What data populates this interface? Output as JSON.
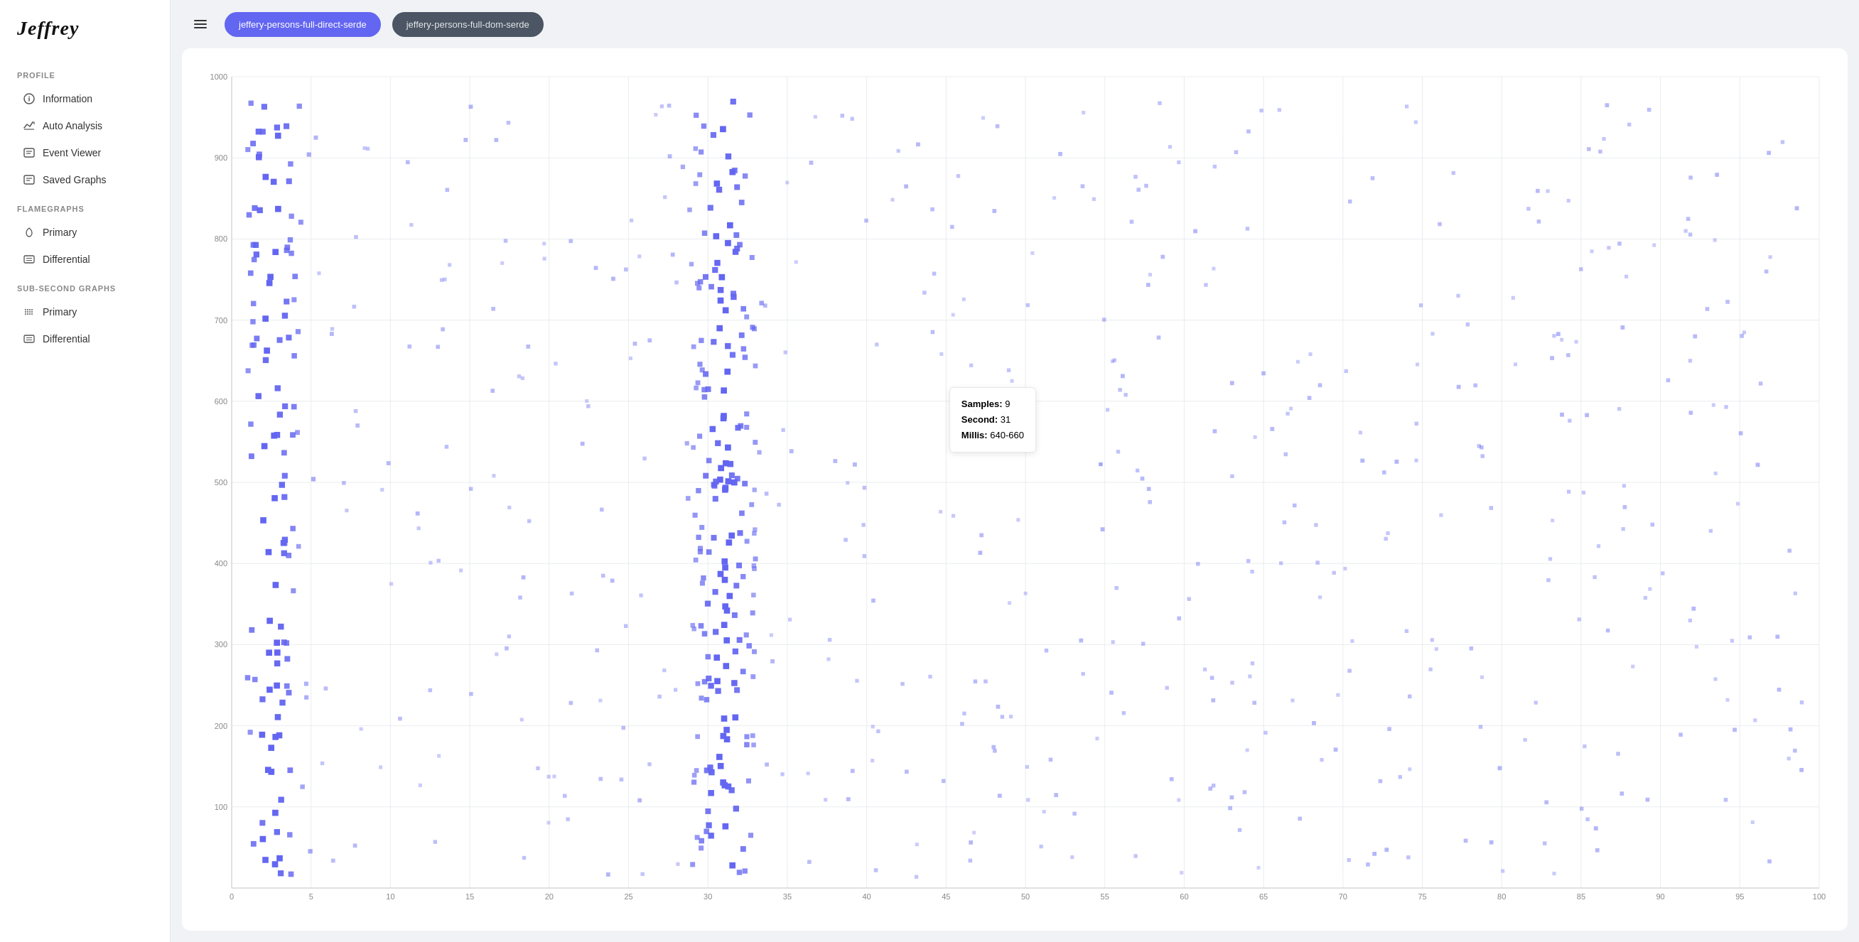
{
  "logo": "Jeffrey",
  "sidebar": {
    "profile_label": "PROFILE",
    "flamegraphs_label": "FLAMEGRAPHS",
    "subsecond_label": "SUB-SECOND GRAPHS",
    "items": {
      "information": "Information",
      "auto_analysis": "Auto Analysis",
      "event_viewer": "Event Viewer",
      "saved_graphs": "Saved Graphs",
      "primary_flame": "Primary",
      "differential_flame": "Differential",
      "primary_sub": "Primary",
      "differential_sub": "Differential"
    }
  },
  "header": {
    "tab1_label": "jeffery-persons-full-direct-serde",
    "tab2_label": "jeffery-persons-full-dom-serde"
  },
  "tooltip": {
    "samples_label": "Samples:",
    "samples_value": "9",
    "second_label": "Second:",
    "second_value": "31",
    "millis_label": "Millis:",
    "millis_value": "640-660"
  },
  "colors": {
    "accent": "#6366f1",
    "inactive_tab": "#4b5563",
    "dot_dark": "#3730a3",
    "dot_mid": "#818cf8",
    "dot_light": "#c7d2fe"
  }
}
